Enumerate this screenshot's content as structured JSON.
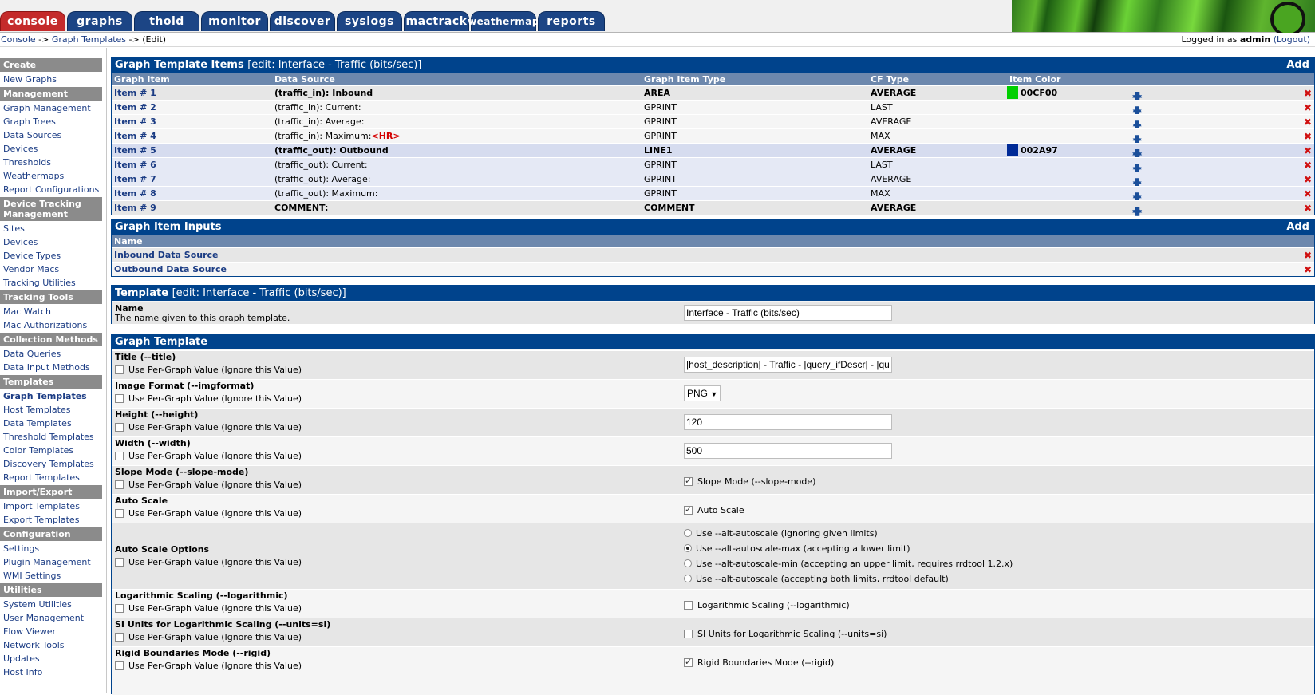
{
  "tabs": [
    {
      "label": "console",
      "active": true,
      "w": 80
    },
    {
      "label": "graphs",
      "active": false,
      "w": 80
    },
    {
      "label": "thold",
      "active": false,
      "w": 80
    },
    {
      "label": "monitor",
      "active": false,
      "w": 82
    },
    {
      "label": "discover",
      "active": false,
      "w": 80
    },
    {
      "label": "syslogs",
      "active": false,
      "w": 80
    },
    {
      "label": "mactrack",
      "active": false,
      "w": 80
    },
    {
      "label": "weathermap",
      "active": false,
      "w": 80
    },
    {
      "label": "reports",
      "active": false,
      "w": 82
    }
  ],
  "breadcrumb": {
    "console": "Console",
    "sep1": " -> ",
    "graph_templates": "Graph Templates",
    "sep2": " -> ",
    "current": "(Edit)"
  },
  "login": {
    "prefix": "Logged in as ",
    "user": "admin",
    "logout": "(Logout)"
  },
  "sidebar": [
    {
      "type": "head",
      "label": "Create"
    },
    {
      "type": "item",
      "label": "New Graphs"
    },
    {
      "type": "head",
      "label": "Management"
    },
    {
      "type": "item",
      "label": "Graph Management"
    },
    {
      "type": "item",
      "label": "Graph Trees"
    },
    {
      "type": "item",
      "label": "Data Sources"
    },
    {
      "type": "item",
      "label": "Devices"
    },
    {
      "type": "item",
      "label": "Thresholds"
    },
    {
      "type": "item",
      "label": "Weathermaps"
    },
    {
      "type": "item",
      "label": "Report Configurations"
    },
    {
      "type": "head",
      "label": "Device Tracking Management"
    },
    {
      "type": "item",
      "label": "Sites"
    },
    {
      "type": "item",
      "label": "Devices"
    },
    {
      "type": "item",
      "label": "Device Types"
    },
    {
      "type": "item",
      "label": "Vendor Macs"
    },
    {
      "type": "item",
      "label": "Tracking Utilities"
    },
    {
      "type": "head",
      "label": "Tracking Tools"
    },
    {
      "type": "item",
      "label": "Mac Watch"
    },
    {
      "type": "item",
      "label": "Mac Authorizations"
    },
    {
      "type": "head",
      "label": "Collection Methods"
    },
    {
      "type": "item",
      "label": "Data Queries"
    },
    {
      "type": "item",
      "label": "Data Input Methods"
    },
    {
      "type": "head",
      "label": "Templates"
    },
    {
      "type": "item",
      "label": "Graph Templates",
      "current": true
    },
    {
      "type": "item",
      "label": "Host Templates"
    },
    {
      "type": "item",
      "label": "Data Templates"
    },
    {
      "type": "item",
      "label": "Threshold Templates"
    },
    {
      "type": "item",
      "label": "Color Templates"
    },
    {
      "type": "item",
      "label": "Discovery Templates"
    },
    {
      "type": "item",
      "label": "Report Templates"
    },
    {
      "type": "head",
      "label": "Import/Export"
    },
    {
      "type": "item",
      "label": "Import Templates"
    },
    {
      "type": "item",
      "label": "Export Templates"
    },
    {
      "type": "head",
      "label": "Configuration"
    },
    {
      "type": "item",
      "label": "Settings"
    },
    {
      "type": "item",
      "label": "Plugin Management"
    },
    {
      "type": "item",
      "label": "WMI Settings"
    },
    {
      "type": "head",
      "label": "Utilities"
    },
    {
      "type": "item",
      "label": "System Utilities"
    },
    {
      "type": "item",
      "label": "User Management"
    },
    {
      "type": "item",
      "label": "Flow Viewer"
    },
    {
      "type": "item",
      "label": "Network Tools"
    },
    {
      "type": "item",
      "label": "Updates"
    },
    {
      "type": "item",
      "label": "Host Info"
    }
  ],
  "items_panel": {
    "title": "Graph Template Items",
    "subtitle": "[edit: Interface - Traffic (bits/sec)]",
    "add": "Add",
    "columns": {
      "item": "Graph Item",
      "source": "Data Source",
      "type": "Graph Item Type",
      "cf": "CF Type",
      "color": "Item Color"
    },
    "rows": [
      {
        "item": "Item # 1",
        "source": "(traffic_in): Inbound",
        "hr": "",
        "type": "AREA",
        "cf": "AVERAGE",
        "color": "00CF00",
        "swatch": "#00CF00",
        "bold": true,
        "bg": "r-a"
      },
      {
        "item": "Item # 2",
        "source": "(traffic_in): Current:",
        "hr": "",
        "type": "GPRINT",
        "cf": "LAST",
        "color": "",
        "swatch": "",
        "bold": false,
        "bg": "r-b"
      },
      {
        "item": "Item # 3",
        "source": "(traffic_in): Average:",
        "hr": "",
        "type": "GPRINT",
        "cf": "AVERAGE",
        "color": "",
        "swatch": "",
        "bold": false,
        "bg": "r-b"
      },
      {
        "item": "Item # 4",
        "source": "(traffic_in): Maximum:",
        "hr": "<HR>",
        "type": "GPRINT",
        "cf": "MAX",
        "color": "",
        "swatch": "",
        "bold": false,
        "bg": "r-b"
      },
      {
        "item": "Item # 5",
        "source": "(traffic_out): Outbound",
        "hr": "",
        "type": "LINE1",
        "cf": "AVERAGE",
        "color": "002A97",
        "swatch": "#002A97",
        "bold": true,
        "bg": "r-d"
      },
      {
        "item": "Item # 6",
        "source": "(traffic_out): Current:",
        "hr": "",
        "type": "GPRINT",
        "cf": "LAST",
        "color": "",
        "swatch": "",
        "bold": false,
        "bg": "r-c"
      },
      {
        "item": "Item # 7",
        "source": "(traffic_out): Average:",
        "hr": "",
        "type": "GPRINT",
        "cf": "AVERAGE",
        "color": "",
        "swatch": "",
        "bold": false,
        "bg": "r-c"
      },
      {
        "item": "Item # 8",
        "source": "(traffic_out): Maximum:",
        "hr": "",
        "type": "GPRINT",
        "cf": "MAX",
        "color": "",
        "swatch": "",
        "bold": false,
        "bg": "r-c"
      },
      {
        "item": "Item # 9",
        "source": "COMMENT:",
        "hr": "",
        "type": "COMMENT",
        "cf": "AVERAGE",
        "color": "",
        "swatch": "",
        "bold": true,
        "bg": "r-a"
      }
    ]
  },
  "inputs_panel": {
    "title": "Graph Item Inputs",
    "add": "Add",
    "column": "Name",
    "rows": [
      "Inbound Data Source",
      "Outbound Data Source"
    ]
  },
  "template_panel": {
    "title": "Template",
    "subtitle": "[edit: Interface - Traffic (bits/sec)]",
    "name_label": "Name",
    "name_desc": "The name given to this graph template.",
    "name_value": "Interface - Traffic (bits/sec)"
  },
  "graph_template": {
    "title": "Graph Template",
    "per_graph": "Use Per-Graph Value (Ignore this Value)",
    "fields": {
      "title": {
        "label": "Title (--title)",
        "value": "|host_description| - Traffic - |query_ifDescr| - |qu"
      },
      "imgformat": {
        "label": "Image Format (--imgformat)",
        "value": "PNG"
      },
      "height": {
        "label": "Height (--height)",
        "value": "120"
      },
      "width": {
        "label": "Width (--width)",
        "value": "500"
      },
      "slope": {
        "label": "Slope Mode (--slope-mode)",
        "value": "Slope Mode (--slope-mode)"
      },
      "autoscale": {
        "label": "Auto Scale",
        "value": "Auto Scale"
      },
      "autoscale_opts": {
        "label": "Auto Scale Options",
        "options": [
          "Use --alt-autoscale (ignoring given limits)",
          "Use --alt-autoscale-max (accepting a lower limit)",
          "Use --alt-autoscale-min (accepting an upper limit, requires rrdtool 1.2.x)",
          "Use --alt-autoscale (accepting both limits, rrdtool default)"
        ],
        "selected": 1
      },
      "log": {
        "label": "Logarithmic Scaling (--logarithmic)",
        "value": "Logarithmic Scaling (--logarithmic)"
      },
      "si": {
        "label": "SI Units for Logarithmic Scaling (--units=si)",
        "value": "SI Units for Logarithmic Scaling (--units=si)"
      },
      "rigid": {
        "label": "Rigid Boundaries Mode (--rigid)",
        "value": "Rigid Boundaries Mode (--rigid)"
      }
    }
  },
  "colors": {
    "header": "#00438c",
    "colhead": "#6d88ad",
    "sidebar_head": "#8b8b8b",
    "link": "#1b3c84",
    "delete": "#d01010"
  }
}
